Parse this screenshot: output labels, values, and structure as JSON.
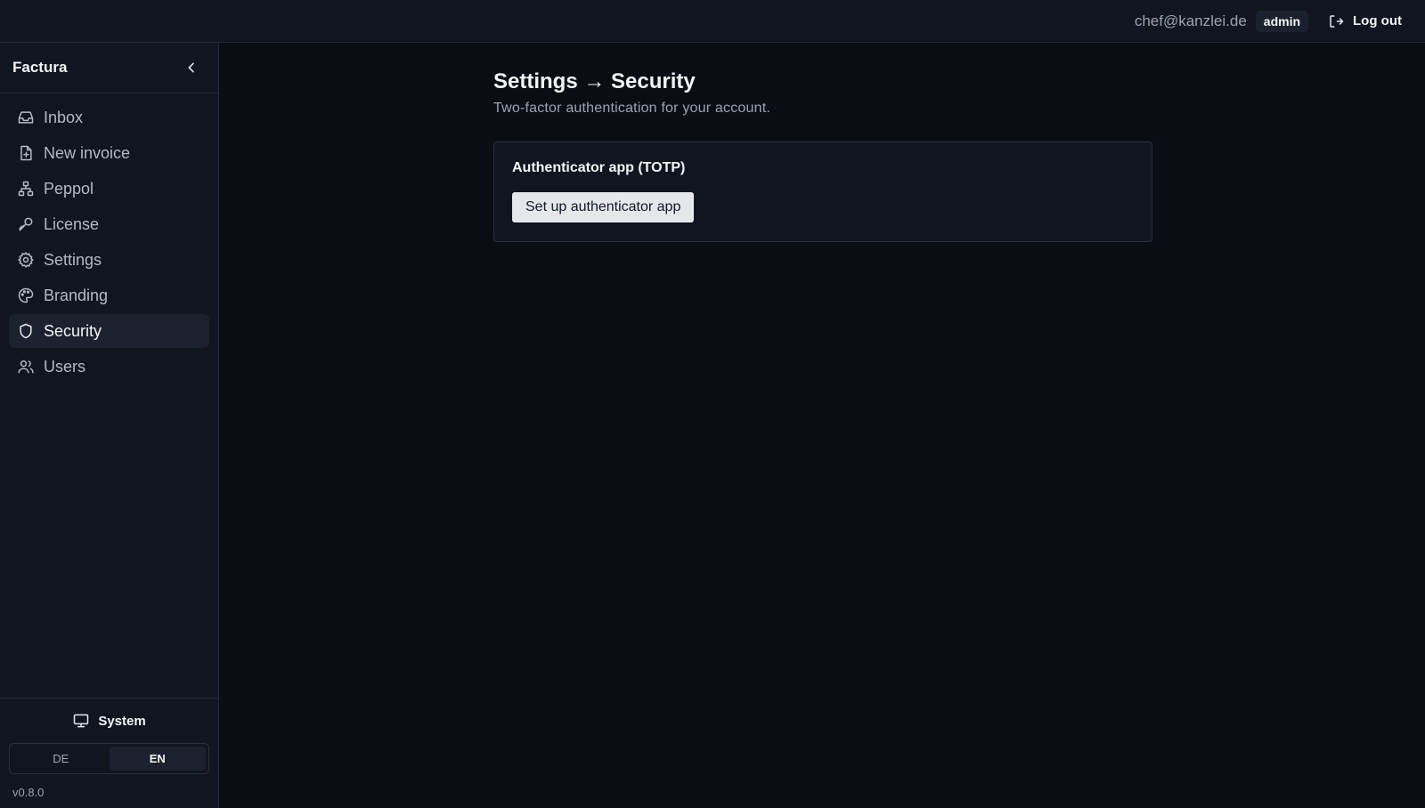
{
  "topbar": {
    "email": "chef@kanzlei.de",
    "role": "admin",
    "logout_label": "Log out",
    "logout_icon": "logout-icon"
  },
  "sidebar": {
    "brand": "Factura",
    "collapse_icon": "chevron-left-icon",
    "items": [
      {
        "label": "Inbox",
        "icon": "inbox-icon",
        "active": false
      },
      {
        "label": "New invoice",
        "icon": "file-plus-icon",
        "active": false
      },
      {
        "label": "Peppol",
        "icon": "network-icon",
        "active": false
      },
      {
        "label": "License",
        "icon": "key-icon",
        "active": false
      },
      {
        "label": "Settings",
        "icon": "gear-icon",
        "active": false
      },
      {
        "label": "Branding",
        "icon": "palette-icon",
        "active": false
      },
      {
        "label": "Security",
        "icon": "shield-icon",
        "active": true
      },
      {
        "label": "Users",
        "icon": "users-icon",
        "active": false
      }
    ],
    "theme_label": "System",
    "theme_icon": "monitor-icon",
    "languages": [
      "DE",
      "EN"
    ],
    "selected_language": "EN",
    "version": "v0.8.0"
  },
  "main": {
    "title": "Settings → Security",
    "subtitle": "Two-factor authentication for your account.",
    "card": {
      "title": "Authenticator app (TOTP)",
      "button_label": "Set up authenticator app"
    }
  }
}
